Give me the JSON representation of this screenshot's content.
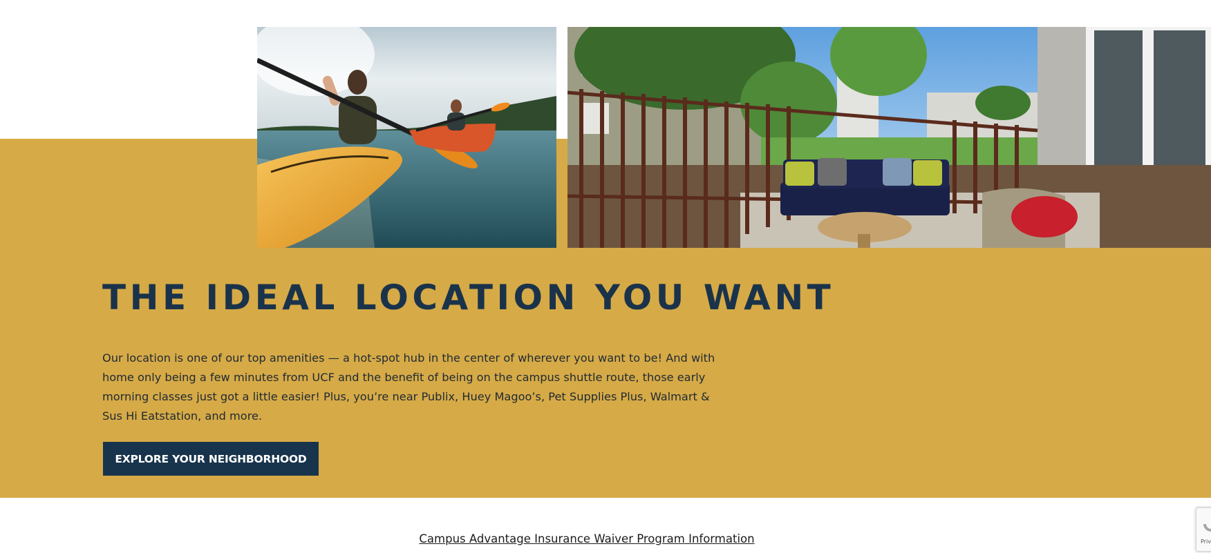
{
  "section": {
    "headline": "THE IDEAL LOCATION YOU WANT",
    "body": "Our location is one of our top amenities — a hot-spot hub in the center of wherever you want to be! And with home only being a few minutes from UCF and the benefit of being on the campus shuttle route, those early morning classes just got a little easier! Plus, you’re near Publix, Huey Magoo’s, Pet Supplies Plus, Walmart & Sus Hi Eatstation, and more.",
    "cta_label": "EXPLORE YOUR NEIGHBORHOOD"
  },
  "footer": {
    "insurance_link": "Campus Advantage Insurance Waiver Program Information"
  },
  "recaptcha": {
    "label": "Priv"
  },
  "colors": {
    "gold": "#d6aa47",
    "navy": "#18344c",
    "white": "#ffffff"
  },
  "icons": {
    "recaptcha": "recaptcha-icon"
  }
}
